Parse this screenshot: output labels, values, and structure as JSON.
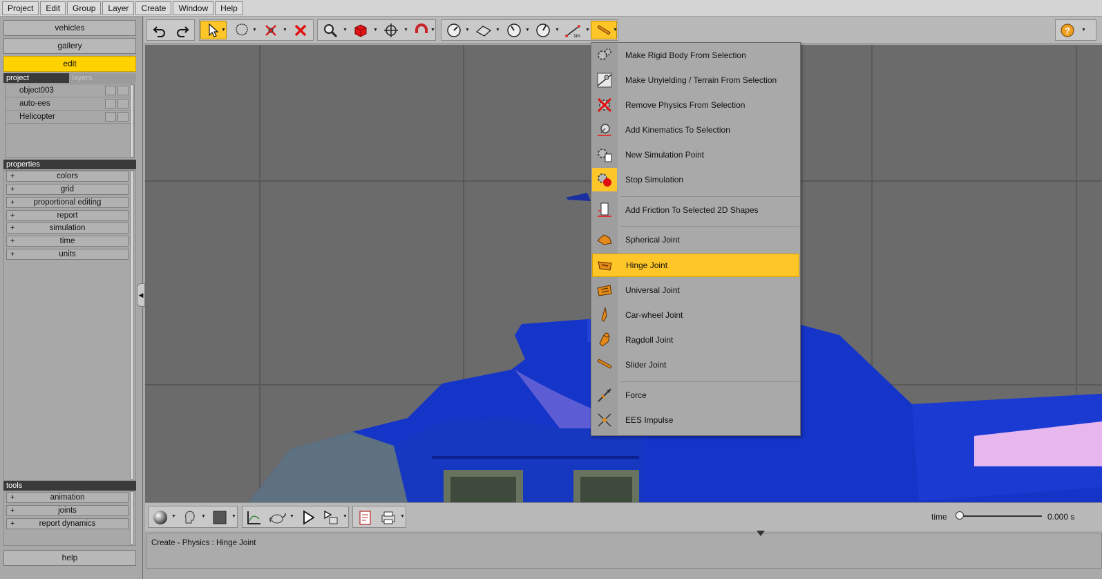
{
  "menubar": {
    "items": [
      "Project",
      "Edit",
      "Group",
      "Layer",
      "Create",
      "Window",
      "Help"
    ]
  },
  "left": {
    "nav": [
      {
        "label": "vehicles",
        "active": false
      },
      {
        "label": "gallery",
        "active": false
      },
      {
        "label": "edit",
        "active": true
      }
    ],
    "tabs": {
      "active": "project",
      "inactive": "layers"
    },
    "project_items": [
      "object003",
      "auto-ees",
      "Helicopter"
    ],
    "properties_header": "properties",
    "properties": [
      "colors",
      "grid",
      "proportional editing",
      "report",
      "simulation",
      "time",
      "units"
    ],
    "tools_header": "tools",
    "tools": [
      "animation",
      "joints",
      "report dynamics"
    ],
    "help": "help",
    "plus": "+"
  },
  "toolbar": {
    "icons": [
      "undo-icon",
      "redo-icon",
      "select-arrow-icon",
      "lasso-icon",
      "scatter-icon",
      "delete-icon",
      "zoom-icon",
      "cube-icon",
      "move-icon",
      "magnet-icon",
      "gauge-icon",
      "plane-tool-icon",
      "dial-icon",
      "dial2-icon",
      "measure-icon",
      "physics-joint-icon",
      "help-icon"
    ],
    "measure_label": "1m",
    "help_glyph": "?"
  },
  "dropdown": {
    "items": [
      {
        "label": "Make Rigid Body From Selection",
        "icon": "gears-icon"
      },
      {
        "label": "Make Unyielding / Terrain From Selection",
        "icon": "terrain-icon"
      },
      {
        "label": "Remove Physics From Selection",
        "icon": "remove-physics-icon"
      },
      {
        "label": "Add Kinematics To Selection",
        "icon": "kinematics-icon"
      },
      {
        "label": "New Simulation Point",
        "icon": "sim-point-icon"
      },
      {
        "label": "Stop Simulation",
        "icon": "stop-sim-icon"
      },
      {
        "label": "Add Friction To Selected 2D Shapes",
        "icon": "friction-icon"
      },
      {
        "label": "Spherical Joint",
        "icon": "spherical-joint-icon"
      },
      {
        "label": "Hinge Joint",
        "icon": "hinge-joint-icon",
        "highlighted": true
      },
      {
        "label": "Universal Joint",
        "icon": "universal-joint-icon"
      },
      {
        "label": "Car-wheel Joint",
        "icon": "car-wheel-joint-icon"
      },
      {
        "label": "Ragdoll Joint",
        "icon": "ragdoll-joint-icon"
      },
      {
        "label": "Slider Joint",
        "icon": "slider-joint-icon"
      },
      {
        "label": "Force",
        "icon": "force-icon"
      },
      {
        "label": "EES Impulse",
        "icon": "impulse-icon"
      }
    ]
  },
  "bottombar": {
    "icons": [
      "sphere-material-icon",
      "head-icon",
      "square-color-icon",
      "graph-icon",
      "teapot-icon",
      "play-icon",
      "play-list-icon",
      "report-icon",
      "print-icon"
    ],
    "time_label": "time",
    "time_value": "0.000 s",
    "time_fraction": 0
  },
  "status": {
    "text": "Create - Physics : Hinge Joint"
  },
  "colors": {
    "accent": "#ffc629",
    "nav_active": "#ffd200",
    "helicopter_blue": "#1534c8"
  }
}
